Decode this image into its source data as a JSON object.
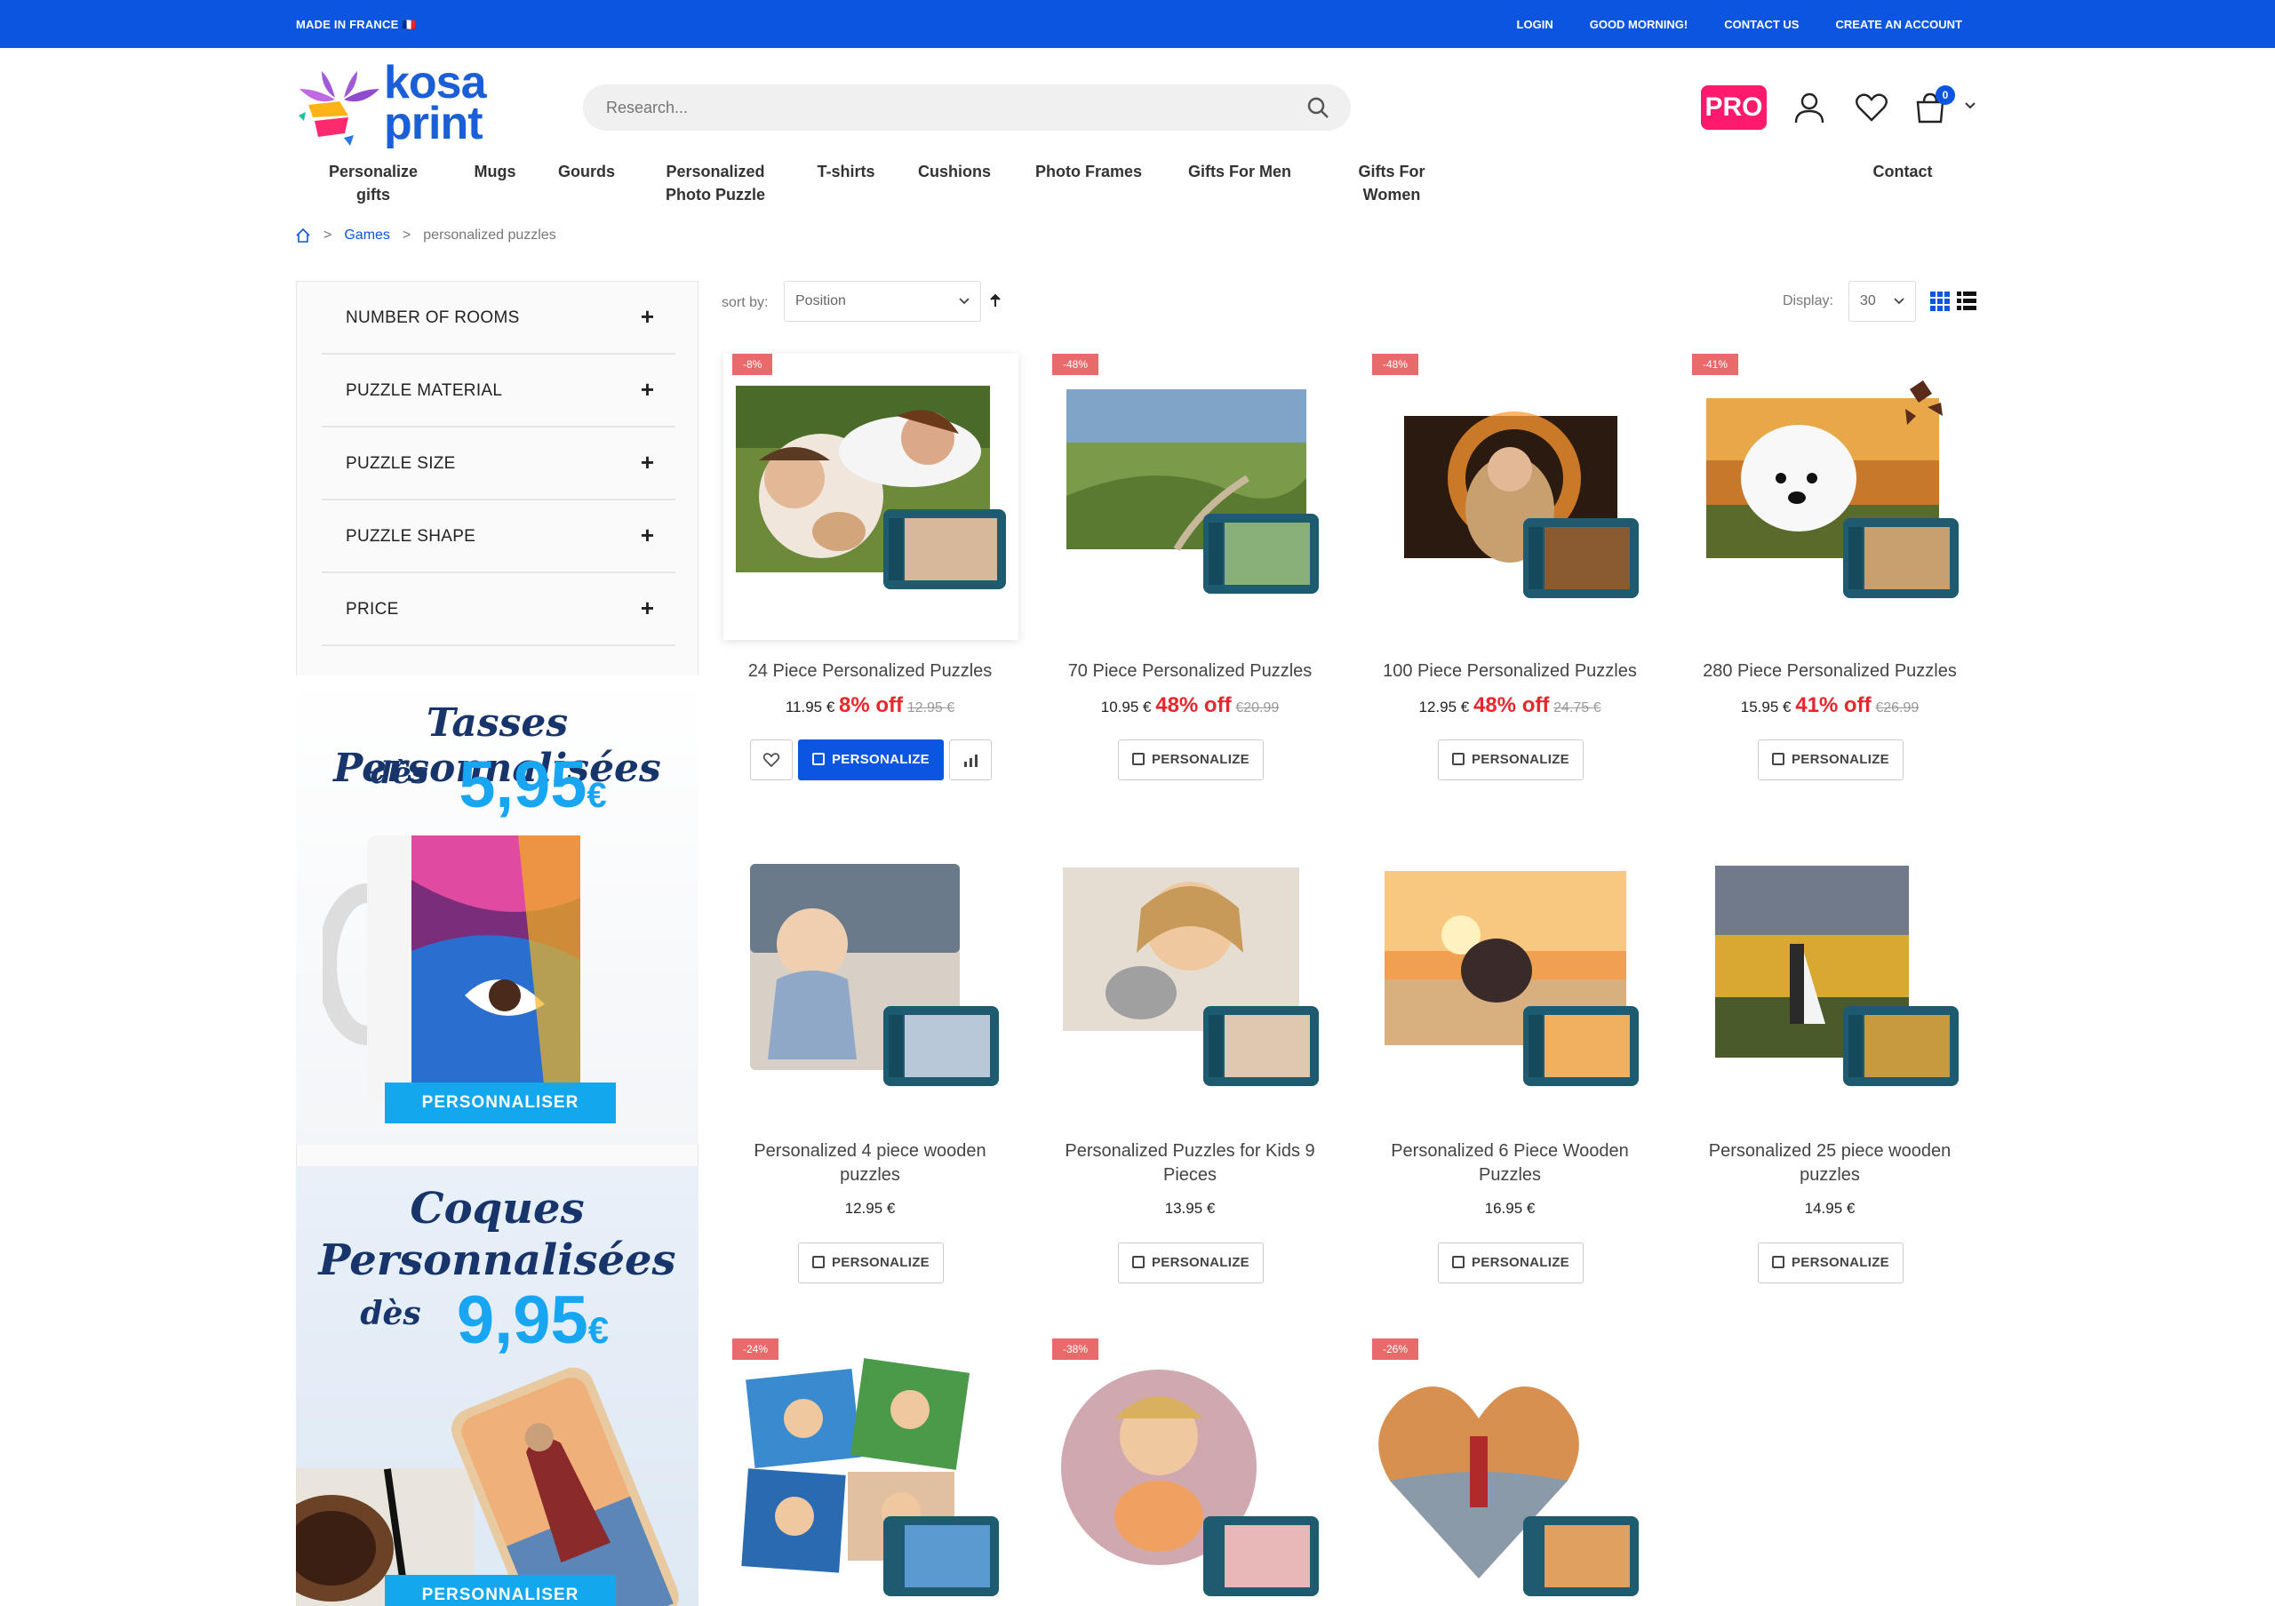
{
  "topbar": {
    "made_in": "MADE IN FRANCE 🇫🇷",
    "login": "LOGIN",
    "greeting": "GOOD MORNING!",
    "contact": "CONTACT US",
    "create": "CREATE AN ACCOUNT"
  },
  "brand": {
    "line1": "kosa",
    "line2": "print"
  },
  "search": {
    "placeholder": "Research..."
  },
  "header": {
    "pro": "PRO",
    "cart_count": "0"
  },
  "nav": {
    "personalize_1": "Personalize",
    "personalize_2": "gifts",
    "mugs": "Mugs",
    "gourds": "Gourds",
    "photo_puzzle_1": "Personalized",
    "photo_puzzle_2": "Photo Puzzle",
    "tshirts": "T-shirts",
    "cushions": "Cushions",
    "frames": "Photo Frames",
    "men": "Gifts For Men",
    "women_1": "Gifts For",
    "women_2": "Women",
    "contact": "Contact"
  },
  "breadcrumb": {
    "games": "Games",
    "current": "personalized puzzles"
  },
  "filters": [
    "NUMBER OF ROOMS",
    "PUZZLE MATERIAL",
    "PUZZLE SIZE",
    "PUZZLE SHAPE",
    "PRICE"
  ],
  "promo1": {
    "line1": "Tasses Personnalisées",
    "from": "dès",
    "price": "5,95",
    "currency": "€",
    "button": "PERSONNALISER"
  },
  "promo2": {
    "line1": "Coques",
    "line2": "Personnalisées",
    "from": "dès",
    "price": "9,95",
    "currency": "€",
    "button": "PERSONNALISER"
  },
  "toolbar": {
    "sort_label": "sort by:",
    "sort_value": "Position",
    "display_label": "Display:",
    "display_value": "30"
  },
  "products": [
    {
      "badge": "-8%",
      "title": "24 Piece Personalized Puzzles",
      "price": "11.95 €",
      "off": "8% off",
      "old": "12.95 €",
      "button": "PERSONALIZE"
    },
    {
      "badge": "-48%",
      "title": "70 Piece Personalized Puzzles",
      "price": "10.95 €",
      "off": "48% off",
      "old": "€20.99",
      "button": "PERSONALIZE"
    },
    {
      "badge": "-48%",
      "title": "100 Piece Personalized Puzzles",
      "price": "12.95 €",
      "off": "48% off",
      "old": "24.75 €",
      "button": "PERSONALIZE"
    },
    {
      "badge": "-41%",
      "title": "280 Piece Personalized Puzzles",
      "price": "15.95 €",
      "off": "41% off",
      "old": "€26.99",
      "button": "PERSONALIZE"
    },
    {
      "title1": "Personalized 4 piece wooden",
      "title2": "puzzles",
      "price": "12.95 €",
      "button": "PERSONALIZE"
    },
    {
      "title1": "Personalized Puzzles for Kids 9",
      "title2": "Pieces",
      "price": "13.95 €",
      "button": "PERSONALIZE"
    },
    {
      "title1": "Personalized 6 Piece Wooden",
      "title2": "Puzzles",
      "price": "16.95 €",
      "button": "PERSONALIZE"
    },
    {
      "title1": "Personalized 25 piece wooden",
      "title2": "puzzles",
      "price": "14.95 €",
      "button": "PERSONALIZE"
    },
    {
      "badge": "-24%"
    },
    {
      "badge": "-38%"
    },
    {
      "badge": "-26%"
    }
  ]
}
